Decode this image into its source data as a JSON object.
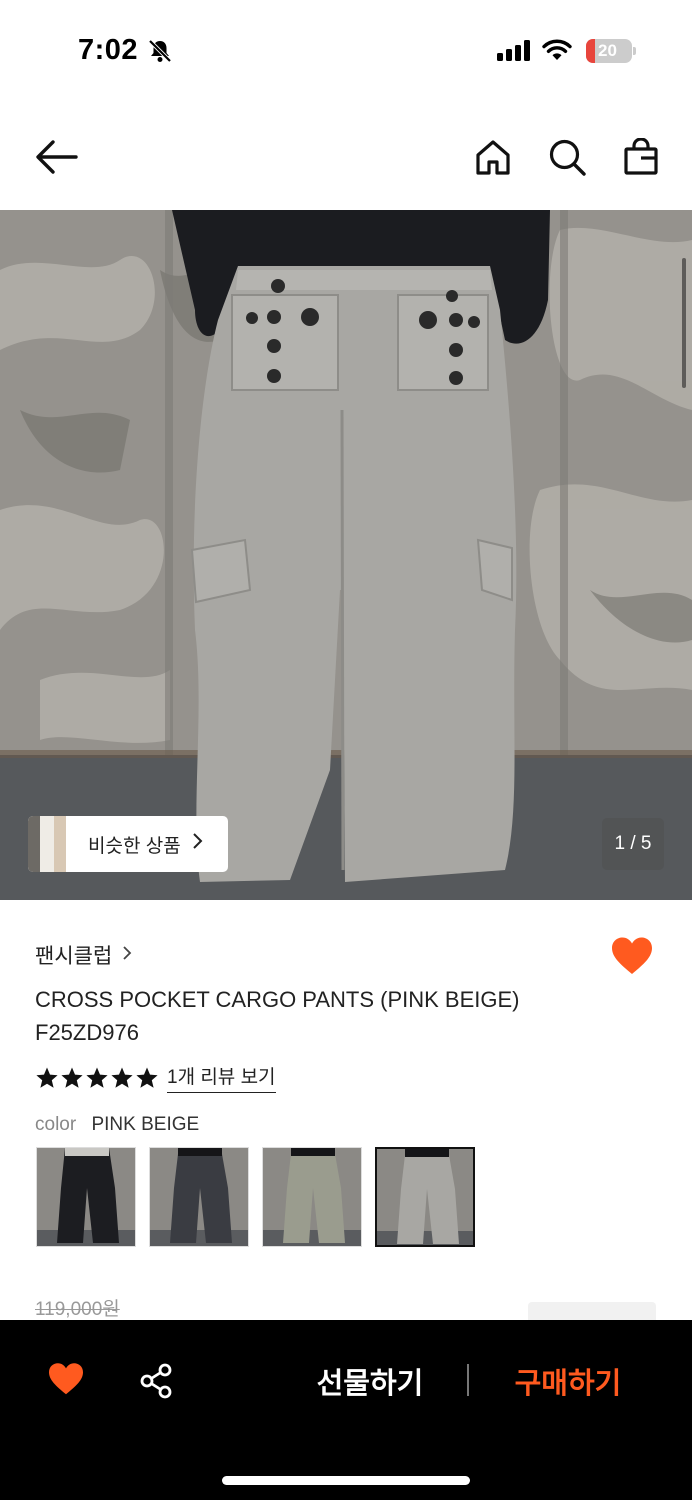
{
  "status_bar": {
    "time": "7:02",
    "battery": "20",
    "battery_level_percent": 20,
    "icons": [
      "bell-slash-icon",
      "signal-icon",
      "wifi-icon",
      "battery-icon"
    ]
  },
  "nav": {
    "icons": [
      "back-arrow-icon",
      "home-icon",
      "search-icon",
      "shopping-bag-icon"
    ]
  },
  "hero": {
    "similar_label": "비슷한 상품",
    "counter": "1 / 5"
  },
  "product": {
    "brand": "팬시클럽",
    "title_line1": "CROSS POCKET CARGO PANTS (PINK BEIGE)",
    "title_line2": "F25ZD976",
    "stars": 5,
    "review_link": "1개 리뷰 보기",
    "color_label": "color",
    "color_value": "PINK BEIGE",
    "swatches": [
      "black",
      "charcoal",
      "khaki",
      "pink-beige"
    ],
    "selected_swatch": 3,
    "price_original": "119,000원"
  },
  "bottom_bar": {
    "gift_label": "선물하기",
    "buy_label": "구매하기",
    "accent_color": "#ff5a1f"
  }
}
